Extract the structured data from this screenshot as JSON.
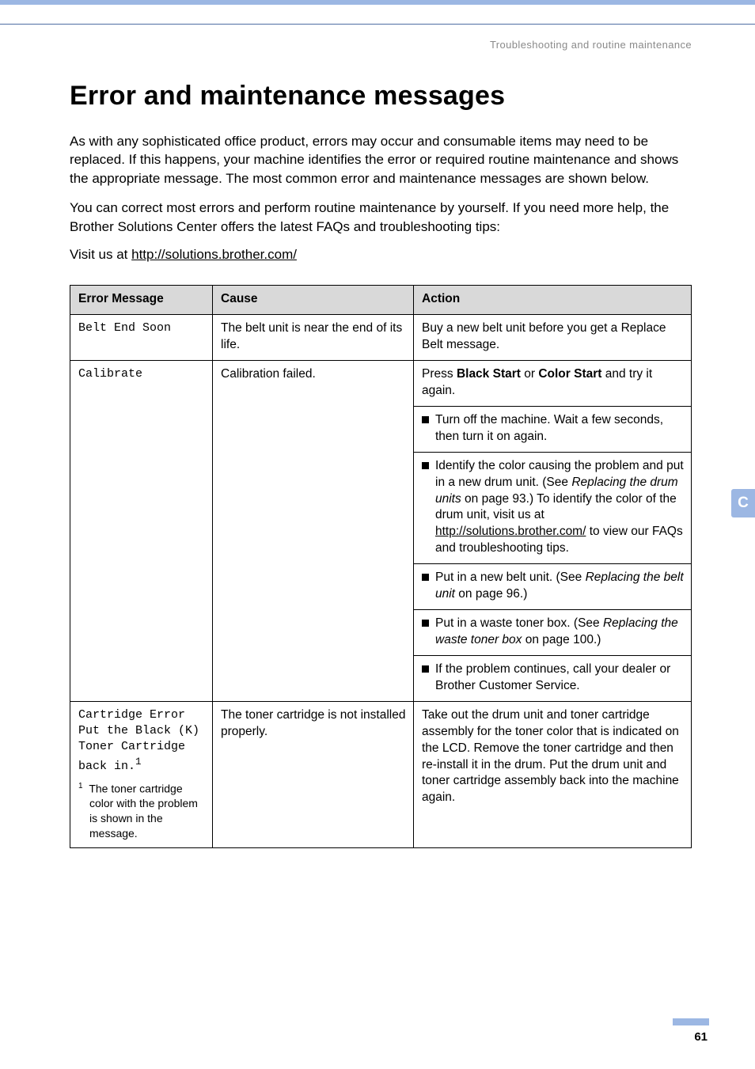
{
  "breadcrumb": "Troubleshooting and routine maintenance",
  "heading": "Error and maintenance messages",
  "para1": "As with any sophisticated office product, errors may occur and consumable items may need to be replaced. If this happens, your machine identifies the error or required routine maintenance and shows the appropriate message. The most common error and maintenance messages are shown below.",
  "para2": "You can correct most errors and perform routine maintenance by yourself. If you need more help, the Brother Solutions Center offers the latest FAQs and troubleshooting tips:",
  "visit_prefix": "Visit us at ",
  "visit_link": "http://solutions.brother.com/",
  "table": {
    "headers": {
      "c1": "Error Message",
      "c2": "Cause",
      "c3": "Action"
    },
    "row1": {
      "msg": "Belt End Soon",
      "cause": "The belt unit is near the end of its life.",
      "action": "Buy a new belt unit before you get a Replace Belt message."
    },
    "row2": {
      "msg": "Calibrate",
      "cause": "Calibration failed.",
      "a1_pre": "Press ",
      "a1_b1": "Black Start",
      "a1_mid": " or ",
      "a1_b2": "Color Start",
      "a1_post": " and try it again.",
      "a2": "Turn off the machine. Wait a few seconds, then turn it on again.",
      "a3_pre": "Identify the color causing the problem and put in a new drum unit. (See ",
      "a3_ital": "Replacing the drum units",
      "a3_mid": " on page 93.) To identify the color of the drum unit, visit us at ",
      "a3_link": "http://solutions.brother.com/",
      "a3_post": " to view our FAQs and troubleshooting tips.",
      "a4_pre": "Put in a new belt unit. (See ",
      "a4_ital": "Replacing the belt unit",
      "a4_post": " on page 96.)",
      "a5_pre": "Put in a waste toner box. (See ",
      "a5_ital": "Replacing the waste toner box",
      "a5_post": " on page 100.)",
      "a6": "If the problem continues, call your dealer or Brother Customer Service."
    },
    "row3": {
      "msg_l1": "Cartridge Error",
      "msg_l2": "Put the Black (K) Toner Cartridge back in.",
      "msg_sup": "1",
      "foot_sup": "1",
      "foot": "The toner cartridge color with the problem is shown in the message.",
      "cause": "The toner cartridge is not installed properly.",
      "action": "Take out the drum unit and toner cartridge assembly for the toner color that is indicated on the LCD. Remove the toner cartridge and then re-install it in the drum. Put the drum unit and toner cartridge assembly back into the machine again."
    }
  },
  "sidetab": "C",
  "pagenum": "61"
}
